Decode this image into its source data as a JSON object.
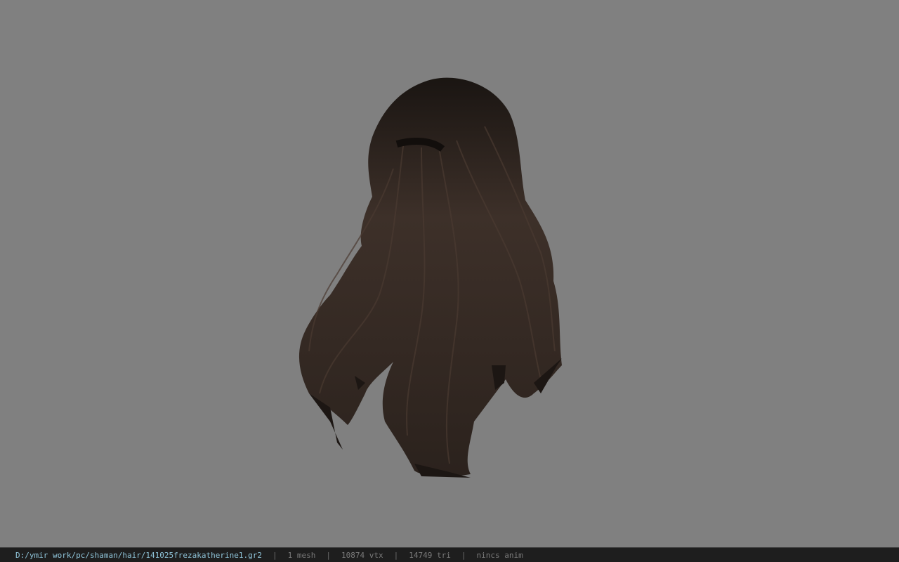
{
  "viewer": {
    "background": "#808080",
    "model": {
      "name": "hair-mesh",
      "color": "#3b2e27"
    }
  },
  "status_bar": {
    "file_path": "D:/ymir work/pc/shaman/hair/141025frezakatherine1.gr2",
    "separator": "|",
    "mesh_count": "1 mesh",
    "vertex_count": "10874 vtx",
    "triangle_count": "14749 tri",
    "anim_status": "nincs anim"
  }
}
